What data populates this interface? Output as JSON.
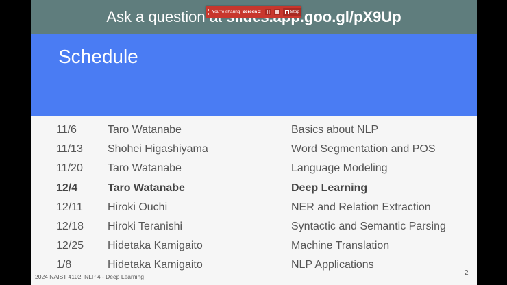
{
  "banner": {
    "prefix": "Ask a question at ",
    "url": "slides.app.goo.gl/pX9Up"
  },
  "sharing_bar": {
    "text": "You're sharing",
    "screen": "Screen 2",
    "stop_label": "Stop",
    "icons": [
      "grip-icon",
      "pause-icon",
      "grid-icon",
      "stop-icon"
    ]
  },
  "slide": {
    "title": "Schedule",
    "footer": "2024 NAIST 4102: NLP 4  - Deep Learning",
    "page_number": "2"
  },
  "schedule": [
    {
      "date": "11/6",
      "lecturer": "Taro Watanabe",
      "topic": "Basics about NLP",
      "current": false
    },
    {
      "date": "11/13",
      "lecturer": "Shohei Higashiyama",
      "topic": "Word Segmentation and POS",
      "current": false
    },
    {
      "date": "11/20",
      "lecturer": "Taro Watanabe",
      "topic": "Language Modeling",
      "current": false
    },
    {
      "date": "12/4",
      "lecturer": "Taro Watanabe",
      "topic": "Deep Learning",
      "current": true
    },
    {
      "date": "12/11",
      "lecturer": "Hiroki Ouchi",
      "topic": "NER and Relation Extraction",
      "current": false
    },
    {
      "date": "12/18",
      "lecturer": "Hiroki Teranishi",
      "topic": "Syntactic and Semantic Parsing",
      "current": false
    },
    {
      "date": "12/25",
      "lecturer": "Hidetaka Kamigaito",
      "topic": "Machine Translation",
      "current": false
    },
    {
      "date": "1/8",
      "lecturer": "Hidetaka Kamigaito",
      "topic": "NLP Applications",
      "current": false
    }
  ],
  "colors": {
    "banner_bg": "#5f7d7d",
    "title_bar_bg": "#4a7cf3",
    "sharing_bar_bg": "#c8372d",
    "slide_bg": "#f6f6f6"
  }
}
